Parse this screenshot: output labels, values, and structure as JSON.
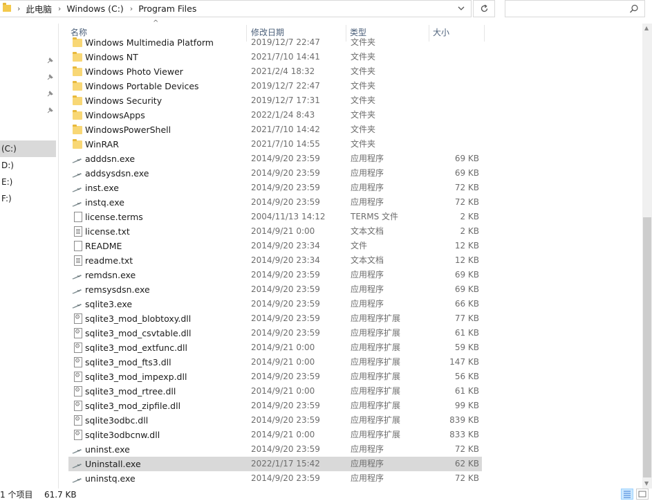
{
  "address": {
    "crumbs": [
      "此电脑",
      "Windows (C:)",
      "Program Files"
    ]
  },
  "columns": {
    "name": "名称",
    "date": "修改日期",
    "type": "类型",
    "size": "大小"
  },
  "nav": {
    "drives": [
      "(C:)",
      "D:)",
      "E:)",
      "F:)"
    ]
  },
  "files": [
    {
      "name": "Windows Multimedia Platform",
      "date": "2019/12/7 22:47",
      "type": "文件夹",
      "size": "",
      "icon": "folder-icon"
    },
    {
      "name": "Windows NT",
      "date": "2021/7/10 14:41",
      "type": "文件夹",
      "size": "",
      "icon": "folder-icon"
    },
    {
      "name": "Windows Photo Viewer",
      "date": "2021/2/4 18:32",
      "type": "文件夹",
      "size": "",
      "icon": "folder-icon"
    },
    {
      "name": "Windows Portable Devices",
      "date": "2019/12/7 22:47",
      "type": "文件夹",
      "size": "",
      "icon": "folder-icon"
    },
    {
      "name": "Windows Security",
      "date": "2019/12/7 17:31",
      "type": "文件夹",
      "size": "",
      "icon": "folder-icon"
    },
    {
      "name": "WindowsApps",
      "date": "2022/1/24 8:43",
      "type": "文件夹",
      "size": "",
      "icon": "folder-icon"
    },
    {
      "name": "WindowsPowerShell",
      "date": "2021/7/10 14:42",
      "type": "文件夹",
      "size": "",
      "icon": "folder-icon"
    },
    {
      "name": "WinRAR",
      "date": "2021/7/10 14:55",
      "type": "文件夹",
      "size": "",
      "icon": "folder-icon"
    },
    {
      "name": "adddsn.exe",
      "date": "2014/9/20 23:59",
      "type": "应用程序",
      "size": "69 KB",
      "icon": "exe-icon"
    },
    {
      "name": "addsysdsn.exe",
      "date": "2014/9/20 23:59",
      "type": "应用程序",
      "size": "69 KB",
      "icon": "exe-icon"
    },
    {
      "name": "inst.exe",
      "date": "2014/9/20 23:59",
      "type": "应用程序",
      "size": "72 KB",
      "icon": "exe-icon"
    },
    {
      "name": "instq.exe",
      "date": "2014/9/20 23:59",
      "type": "应用程序",
      "size": "72 KB",
      "icon": "exe-icon"
    },
    {
      "name": "license.terms",
      "date": "2004/11/13 14:12",
      "type": "TERMS 文件",
      "size": "2 KB",
      "icon": "document-icon"
    },
    {
      "name": "license.txt",
      "date": "2014/9/21 0:00",
      "type": "文本文档",
      "size": "2 KB",
      "icon": "text-file-icon"
    },
    {
      "name": "README",
      "date": "2014/9/20 23:34",
      "type": "文件",
      "size": "12 KB",
      "icon": "document-icon"
    },
    {
      "name": "readme.txt",
      "date": "2014/9/20 23:34",
      "type": "文本文档",
      "size": "12 KB",
      "icon": "text-file-icon"
    },
    {
      "name": "remdsn.exe",
      "date": "2014/9/20 23:59",
      "type": "应用程序",
      "size": "69 KB",
      "icon": "exe-icon"
    },
    {
      "name": "remsysdsn.exe",
      "date": "2014/9/20 23:59",
      "type": "应用程序",
      "size": "69 KB",
      "icon": "exe-icon"
    },
    {
      "name": "sqlite3.exe",
      "date": "2014/9/20 23:59",
      "type": "应用程序",
      "size": "66 KB",
      "icon": "exe-icon"
    },
    {
      "name": "sqlite3_mod_blobtoxy.dll",
      "date": "2014/9/20 23:59",
      "type": "应用程序扩展",
      "size": "77 KB",
      "icon": "dll-icon"
    },
    {
      "name": "sqlite3_mod_csvtable.dll",
      "date": "2014/9/20 23:59",
      "type": "应用程序扩展",
      "size": "61 KB",
      "icon": "dll-icon"
    },
    {
      "name": "sqlite3_mod_extfunc.dll",
      "date": "2014/9/21 0:00",
      "type": "应用程序扩展",
      "size": "59 KB",
      "icon": "dll-icon"
    },
    {
      "name": "sqlite3_mod_fts3.dll",
      "date": "2014/9/21 0:00",
      "type": "应用程序扩展",
      "size": "147 KB",
      "icon": "dll-icon"
    },
    {
      "name": "sqlite3_mod_impexp.dll",
      "date": "2014/9/20 23:59",
      "type": "应用程序扩展",
      "size": "56 KB",
      "icon": "dll-icon"
    },
    {
      "name": "sqlite3_mod_rtree.dll",
      "date": "2014/9/21 0:00",
      "type": "应用程序扩展",
      "size": "61 KB",
      "icon": "dll-icon"
    },
    {
      "name": "sqlite3_mod_zipfile.dll",
      "date": "2014/9/20 23:59",
      "type": "应用程序扩展",
      "size": "99 KB",
      "icon": "dll-icon"
    },
    {
      "name": "sqlite3odbc.dll",
      "date": "2014/9/20 23:59",
      "type": "应用程序扩展",
      "size": "839 KB",
      "icon": "dll-icon"
    },
    {
      "name": "sqlite3odbcnw.dll",
      "date": "2014/9/21 0:00",
      "type": "应用程序扩展",
      "size": "833 KB",
      "icon": "dll-icon"
    },
    {
      "name": "uninst.exe",
      "date": "2014/9/20 23:59",
      "type": "应用程序",
      "size": "72 KB",
      "icon": "exe-icon"
    },
    {
      "name": "Uninstall.exe",
      "date": "2022/1/17 15:42",
      "type": "应用程序",
      "size": "62 KB",
      "icon": "exe-icon",
      "selected": true
    },
    {
      "name": "uninstq.exe",
      "date": "2014/9/20 23:59",
      "type": "应用程序",
      "size": "72 KB",
      "icon": "exe-icon"
    }
  ],
  "status": {
    "selection_text": "1 个项目",
    "selected_size": "61.7 KB"
  }
}
